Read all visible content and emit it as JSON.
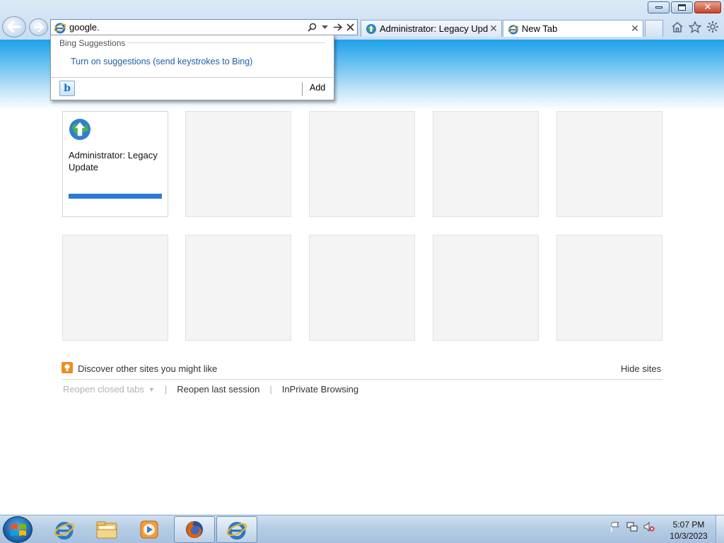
{
  "browser": {
    "address": {
      "value": "google.",
      "placeholder": ""
    },
    "tabs": [
      {
        "title": "Administrator: Legacy Upd...",
        "active": false,
        "icon": "legacy-update-globe-icon"
      },
      {
        "title": "New Tab",
        "active": true,
        "icon": "ie-logo-icon"
      }
    ],
    "close_glyph": "✕",
    "window_controls": [
      "minimize",
      "restore",
      "close"
    ]
  },
  "suggestions": {
    "header": "Bing Suggestions",
    "link": "Turn on suggestions (send keystrokes to Bing)",
    "add_label": "Add",
    "bing_glyph": "b"
  },
  "new_tab_page": {
    "tiles": [
      {
        "title": "Administrator: Legacy Update",
        "icon": "legacy-update-globe-icon"
      },
      {
        "title": ""
      },
      {
        "title": ""
      },
      {
        "title": ""
      },
      {
        "title": ""
      },
      {
        "title": ""
      },
      {
        "title": ""
      },
      {
        "title": ""
      },
      {
        "title": ""
      },
      {
        "title": ""
      }
    ],
    "discover_text": "Discover other sites you might like",
    "hide_sites": "Hide sites",
    "reopen_closed_tabs": "Reopen closed tabs",
    "reopen_last_session": "Reopen last session",
    "inprivate_browsing": "InPrivate Browsing",
    "separator": "|"
  },
  "taskbar": {
    "items": [
      {
        "name": "internet-explorer",
        "state": "pinned"
      },
      {
        "name": "windows-explorer",
        "state": "pinned"
      },
      {
        "name": "windows-media-player",
        "state": "pinned"
      },
      {
        "name": "firefox",
        "state": "running"
      },
      {
        "name": "internet-explorer",
        "state": "running"
      }
    ],
    "clock": {
      "time": "5:07 PM",
      "date": "10/3/2023"
    }
  },
  "colors": {
    "band_top": "#1da0e8",
    "accent_link": "#1f5fa8",
    "progress": "#2b7bd3",
    "discover_icon": "#f08c1d"
  }
}
